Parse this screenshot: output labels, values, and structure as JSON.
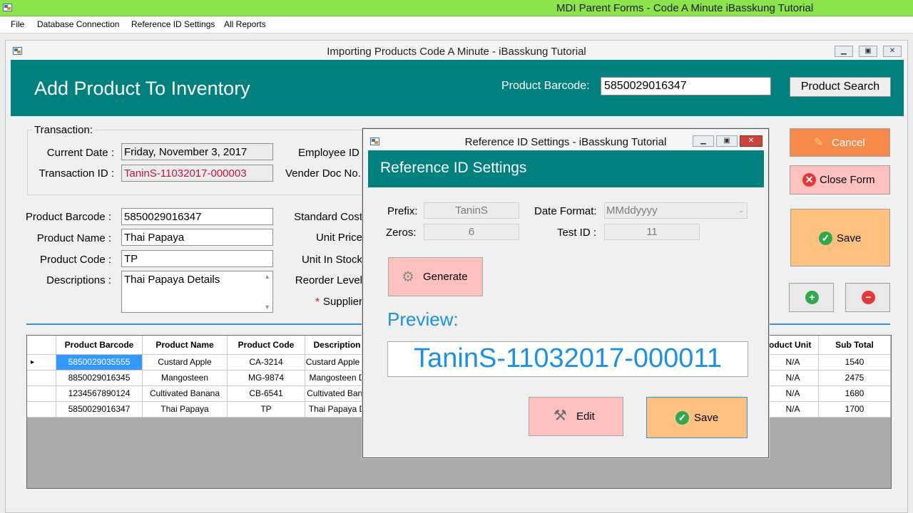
{
  "mdi": {
    "title": "MDI Parent Forms - Code A Minute iBasskung Tutorial",
    "menu": [
      "File",
      "Database Connection",
      "Reference ID Settings",
      "All Reports"
    ]
  },
  "child": {
    "title": "Importing Products Code A Minute - iBasskung Tutorial",
    "header_title": "Add Product To Inventory",
    "barcode_label": "Product Barcode:",
    "barcode_value": "5850029016347",
    "search_button": "Product Search",
    "transaction": {
      "legend": "Transaction:",
      "current_date_label": "Current Date :",
      "current_date": "Friday, November 3, 2017",
      "transaction_id_label": "Transaction ID :",
      "transaction_id": "TaninS-11032017-000003",
      "employee_label": "Employee ID",
      "vender_label": "Vender Doc No."
    },
    "product": {
      "barcode_label": "Product Barcode :",
      "barcode": "5850029016347",
      "name_label": "Product Name :",
      "name": "Thai Papaya",
      "code_label": "Product Code :",
      "code": "TP",
      "desc_label": "Descriptions :",
      "desc": "Thai Papaya Details",
      "standard_cost_label": "Standard Cost",
      "unit_price_label": "Unit Price",
      "unit_in_stock_label": "Unit In Stock",
      "reorder_label": "Reorder Level",
      "supplier_star": "*",
      "supplier_label": "Supplier"
    },
    "buttons": {
      "cancel": "Cancel",
      "close_form": "Close Form",
      "save": "Save"
    },
    "grid": {
      "headers_left": [
        "Product Barcode",
        "Product Name",
        "Product Code",
        "Description"
      ],
      "headers_right": [
        "oduct Unit",
        "Sub Total"
      ],
      "rows": [
        {
          "barcode": "5850029035555",
          "name": "Custard Apple",
          "code": "CA-3214",
          "desc": "Custard Apple D",
          "unit": "N/A",
          "subtotal": "1540"
        },
        {
          "barcode": "8850029016345",
          "name": "Mangosteen",
          "code": "MG-9874",
          "desc": "Mangosteen D",
          "unit": "N/A",
          "subtotal": "2475"
        },
        {
          "barcode": "1234567890124",
          "name": "Cultivated Banana",
          "code": "CB-6541",
          "desc": "Cultivated Bana",
          "unit": "N/A",
          "subtotal": "1680"
        },
        {
          "barcode": "5850029016347",
          "name": "Thai Papaya",
          "code": "TP",
          "desc": "Thai Papaya D",
          "unit": "N/A",
          "subtotal": "1700"
        }
      ],
      "row_indicator": "▸"
    }
  },
  "dialog": {
    "title": "Reference ID Settings - iBasskung Tutorial",
    "heading": "Reference ID Settings",
    "prefix_label": "Prefix:",
    "prefix": "TaninS",
    "zeros_label": "Zeros:",
    "zeros": "6",
    "date_format_label": "Date Format:",
    "date_format": "MMddyyyy",
    "test_id_label": "Test ID :",
    "test_id": "11",
    "generate": "Generate",
    "preview_label": "Preview:",
    "preview": "TaninS-11032017-000011",
    "edit": "Edit",
    "save": "Save"
  },
  "colors": {
    "teal": "#018080",
    "mdi_bar": "#8ce34c",
    "cancel_btn": "#f58a4b",
    "close_btn": "#ffc0c0",
    "save_btn": "#ffc080",
    "preview_text": "#1e90e0",
    "transaction_id_text": "#c0143c",
    "grid_selected": "#3399ff"
  },
  "icons": {
    "app": "app-icon",
    "cancel": "pencil-icon",
    "close": "close-circle-icon",
    "save": "check-circle-icon",
    "add": "plus-circle-icon",
    "remove": "minus-circle-icon",
    "generate": "gears-icon",
    "edit": "tools-icon"
  }
}
